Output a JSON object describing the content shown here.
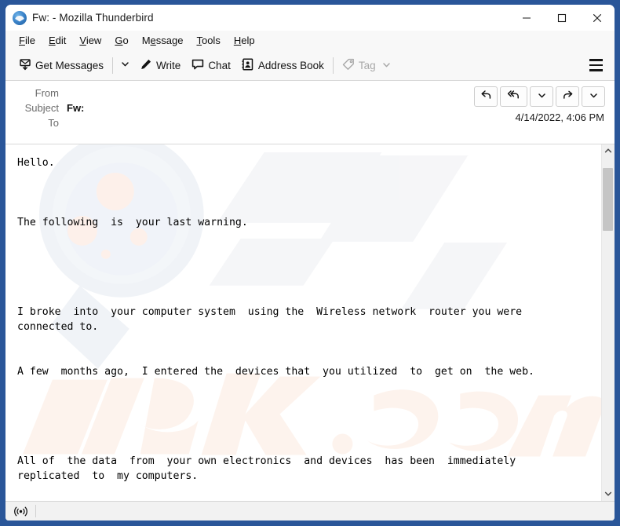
{
  "window": {
    "title": "Fw: - Mozilla Thunderbird",
    "app_icon": "thunderbird-logo-icon",
    "border_color": "#2a5699",
    "controls": {
      "minimize": "minimize-icon",
      "maximize": "maximize-icon",
      "close": "close-icon"
    }
  },
  "menubar": {
    "items": [
      {
        "label": "File",
        "accesskey": "F"
      },
      {
        "label": "Edit",
        "accesskey": "E"
      },
      {
        "label": "View",
        "accesskey": "V"
      },
      {
        "label": "Go",
        "accesskey": "G"
      },
      {
        "label": "Message",
        "accesskey": "M"
      },
      {
        "label": "Tools",
        "accesskey": "T"
      },
      {
        "label": "Help",
        "accesskey": "H"
      }
    ]
  },
  "toolbar": {
    "get_messages_label": "Get Messages",
    "get_messages_icon": "download-mail-icon",
    "get_messages_dropdown_icon": "chevron-down-icon",
    "write_label": "Write",
    "write_icon": "pencil-icon",
    "chat_label": "Chat",
    "chat_icon": "chat-bubble-icon",
    "address_book_label": "Address Book",
    "address_book_icon": "address-book-icon",
    "tag_label": "Tag",
    "tag_icon": "tag-icon",
    "tag_dropdown_icon": "chevron-down-icon",
    "tag_disabled": true,
    "app_menu_icon": "hamburger-menu-icon"
  },
  "message_header": {
    "from_label": "From",
    "from_value": "",
    "subject_label": "Subject",
    "subject_value": "Fw:",
    "to_label": "To",
    "to_value": "",
    "date": "4/14/2022, 4:06 PM",
    "actions": [
      {
        "name": "reply-button",
        "icon": "reply-arrow-icon"
      },
      {
        "name": "reply-all-button",
        "icon": "reply-all-arrow-icon"
      },
      {
        "name": "reply-dropdown-button",
        "icon": "chevron-down-icon"
      },
      {
        "name": "forward-button",
        "icon": "forward-arrow-icon"
      },
      {
        "name": "forward-dropdown-button",
        "icon": "chevron-down-icon"
      }
    ]
  },
  "message_body": {
    "text": "Hello.\n\n\n\nThe following  is  your last warning.\n\n\n\n\n\nI broke  into  your computer system  using the  Wireless network  router you were\nconnected to.\n\n\nA few  months ago,  I entered the  devices that  you utilized  to  get on  the web.\n\n\n\n\n\nAll of  the data  from  your own electronics  and devices  has been  immediately\nreplicated  to  my computers.",
    "watermark_text": "risk.com",
    "watermark_color": "#fdf1ea",
    "font": "monospace"
  },
  "scrollbar": {
    "up_arrow_icon": "chevron-up-icon",
    "down_arrow_icon": "chevron-down-icon",
    "thumb_position_percent": 3
  },
  "statusbar": {
    "icon": "broadcast-signal-icon"
  }
}
